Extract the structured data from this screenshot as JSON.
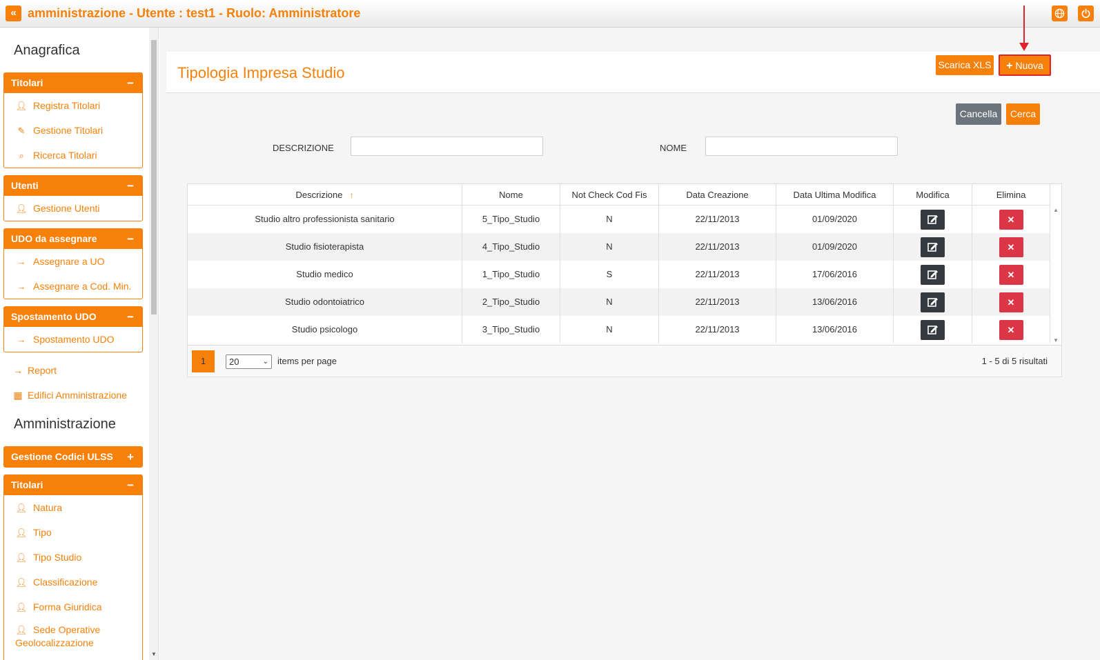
{
  "topbar": {
    "title": "amministrazione - Utente : test1 - Ruolo: Amministratore",
    "collapse_icon": "«"
  },
  "sidebar": {
    "section1": "Anagrafica",
    "titolari": {
      "title": "Titolari",
      "toggle": "−",
      "items": [
        {
          "label": "Registra Titolari",
          "icon": "user-edit-icon"
        },
        {
          "label": "Gestione Titolari",
          "icon": "edit-icon"
        },
        {
          "label": "Ricerca Titolari",
          "icon": "search-icon"
        }
      ]
    },
    "utenti": {
      "title": "Utenti",
      "toggle": "−",
      "items": [
        {
          "label": "Gestione Utenti",
          "icon": "user-edit-icon"
        }
      ]
    },
    "udo": {
      "title": "UDO da assegnare",
      "toggle": "−",
      "items": [
        {
          "label": "Assegnare a UO",
          "icon": "arrow-right-icon"
        },
        {
          "label": "Assegnare a Cod. Min.",
          "icon": "arrow-right-icon"
        }
      ]
    },
    "spostamento": {
      "title": "Spostamento UDO",
      "toggle": "−",
      "items": [
        {
          "label": "Spostamento UDO",
          "icon": "arrow-right-icon"
        }
      ]
    },
    "report": "Report",
    "edifici": "Edifici Amministrazione",
    "section2": "Amministrazione",
    "codici": {
      "title": "Gestione Codici ULSS",
      "toggle": "+"
    },
    "titolari2": {
      "title": "Titolari",
      "toggle": "−",
      "items": [
        {
          "label": "Natura",
          "icon": "user-edit-icon"
        },
        {
          "label": "Tipo",
          "icon": "user-edit-icon"
        },
        {
          "label": "Tipo Studio",
          "icon": "user-edit-icon"
        },
        {
          "label": "Classificazione",
          "icon": "user-edit-icon"
        },
        {
          "label": "Forma Giuridica",
          "icon": "user-edit-icon"
        },
        {
          "label": "Sede Operative",
          "icon": "user-edit-icon"
        },
        {
          "label": "Geolocalizzazione",
          "icon": "user-edit-icon"
        }
      ]
    }
  },
  "main": {
    "title": "Tipologia Impresa Studio",
    "scarica_xls": "Scarica XLS",
    "nuova": "Nuova",
    "cancella": "Cancella",
    "cerca": "Cerca",
    "filters": {
      "descrizione_label": "DESCRIZIONE",
      "descrizione_value": "",
      "nome_label": "NOME",
      "nome_value": ""
    },
    "table": {
      "columns": [
        "Descrizione",
        "Nome",
        "Not Check Cod Fis",
        "Data Creazione",
        "Data Ultima Modifica",
        "Modifica",
        "Elimina"
      ],
      "rows": [
        [
          "Studio altro professionista sanitario",
          "5_Tipo_Studio",
          "N",
          "22/11/2013",
          "01/09/2020"
        ],
        [
          "Studio fisioterapista",
          "4_Tipo_Studio",
          "N",
          "22/11/2013",
          "01/09/2020"
        ],
        [
          "Studio medico",
          "1_Tipo_Studio",
          "S",
          "22/11/2013",
          "17/06/2016"
        ],
        [
          "Studio odontoiatrico",
          "2_Tipo_Studio",
          "N",
          "22/11/2013",
          "13/06/2016"
        ],
        [
          "Studio psicologo",
          "3_Tipo_Studio",
          "N",
          "22/11/2013",
          "13/06/2016"
        ]
      ],
      "delete_symbol": "✕"
    },
    "pager": {
      "current_page": "1",
      "page_size": "20",
      "items_per_page": "items per page",
      "results": "1 - 5 di 5 risultati"
    }
  },
  "colors": {
    "accent": "#f7800a",
    "danger": "#dc3545",
    "dark": "#343a40",
    "secondary": "#6c757d",
    "highlight": "#e0232b"
  }
}
